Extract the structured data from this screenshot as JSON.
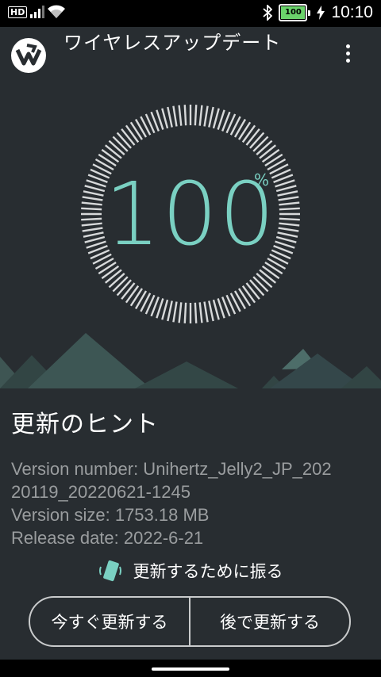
{
  "status_bar": {
    "hd": "HD",
    "battery": "100",
    "time": "10:10",
    "battery_color": "#6bd36b"
  },
  "app_bar": {
    "title": "ワイヤレスアップデート",
    "logo_icon": "wireless-update-logo",
    "menu_icon": "overflow-menu-icon"
  },
  "progress": {
    "value": "100",
    "unit": "%",
    "fraction": 1.0,
    "accent": "#7ad0c2"
  },
  "tips": {
    "title": "更新のヒント",
    "version_number_line1": "Version number: Unihertz_Jelly2_JP_202",
    "version_number_line2": "20119_20220621-1245",
    "version_size": "Version size: 1753.18 MB",
    "release_date": "Release date: 2022-6-21"
  },
  "shake": {
    "label": "更新するために振る",
    "icon": "shake-phone-icon"
  },
  "actions": {
    "update_now": "今すぐ更新する",
    "update_later": "後で更新する"
  }
}
